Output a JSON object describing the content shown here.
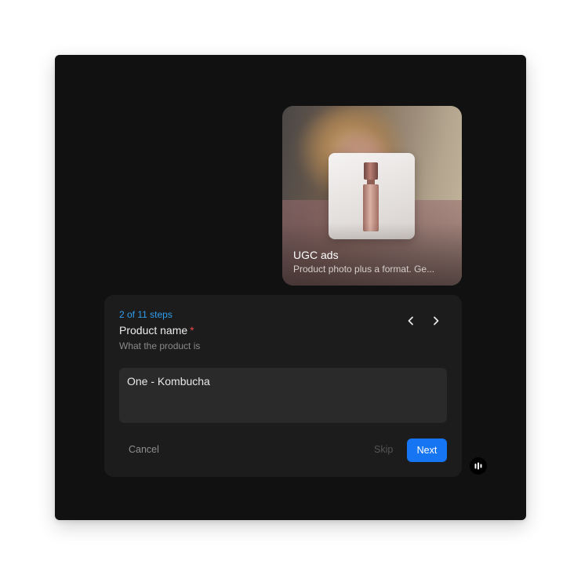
{
  "card": {
    "title": "UGC ads",
    "subtitle": "Product photo plus a format. Ge..."
  },
  "wizard": {
    "step_counter": "2 of 11 steps",
    "field_label": "Product name",
    "required_mark": "*",
    "field_hint": "What the product is",
    "input_value": "One - Kombucha",
    "prev_icon": "chevron-left-icon",
    "next_icon": "chevron-right-icon"
  },
  "actions": {
    "cancel_label": "Cancel",
    "skip_label": "Skip",
    "next_label": "Next"
  },
  "fab": {
    "icon": "bars-logo-icon"
  },
  "colors": {
    "accent": "#1675f2",
    "step_counter": "#2f9ef0",
    "required": "#e5484d",
    "background": "#111111",
    "panel": "#1c1c1c",
    "input": "#2a2a2a"
  }
}
